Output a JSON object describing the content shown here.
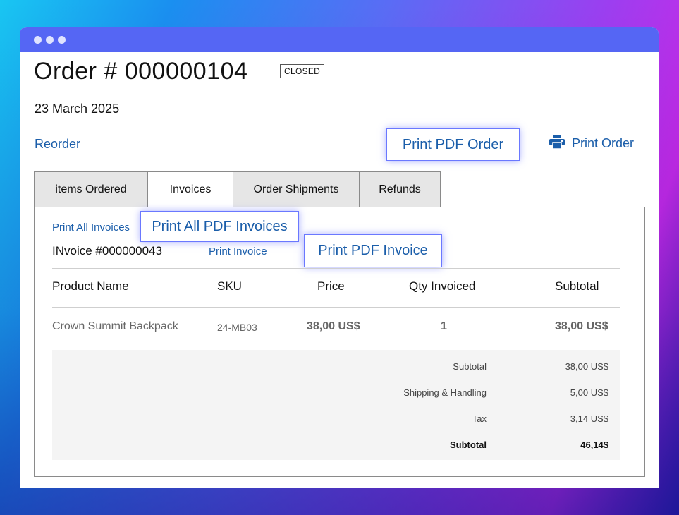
{
  "order": {
    "title": "Order # 000000104",
    "status": "CLOSED",
    "date": "23 March 2025"
  },
  "actions": {
    "reorder": "Reorder",
    "print_pdf_order": "Print PDF Order",
    "print_order": "Print Order"
  },
  "tabs": [
    {
      "label": "items Ordered"
    },
    {
      "label": "Invoices"
    },
    {
      "label": "Order Shipments"
    },
    {
      "label": "Refunds"
    }
  ],
  "invoices": {
    "print_all_link": "Print All Invoices",
    "print_all_pdf": "Print All PDF Invoices",
    "invoice_number": "INvoice #000000043",
    "print_invoice_link": "Print Invoice",
    "print_pdf_invoice": "Print PDF Invoice",
    "columns": {
      "product": "Product Name",
      "sku": "SKU",
      "price": "Price",
      "qty": "Qty Invoiced",
      "subtotal": "Subtotal"
    },
    "rows": [
      {
        "product": "Crown Summit Backpack",
        "sku": "24-MB03",
        "price": "38,00 US$",
        "qty": "1",
        "subtotal": "38,00 US$"
      }
    ],
    "totals": [
      {
        "label": "Subtotal",
        "value": "38,00 US$"
      },
      {
        "label": "Shipping & Handling",
        "value": "5,00 US$"
      },
      {
        "label": "Tax",
        "value": "3,14 US$"
      },
      {
        "label": "Subtotal",
        "value": "46,14$"
      }
    ]
  },
  "icons": {
    "printer": "printer-icon"
  },
  "colors": {
    "link": "#1b5eaa",
    "titlebar": "#5566f4",
    "highlight_border": "#6a78ff"
  }
}
